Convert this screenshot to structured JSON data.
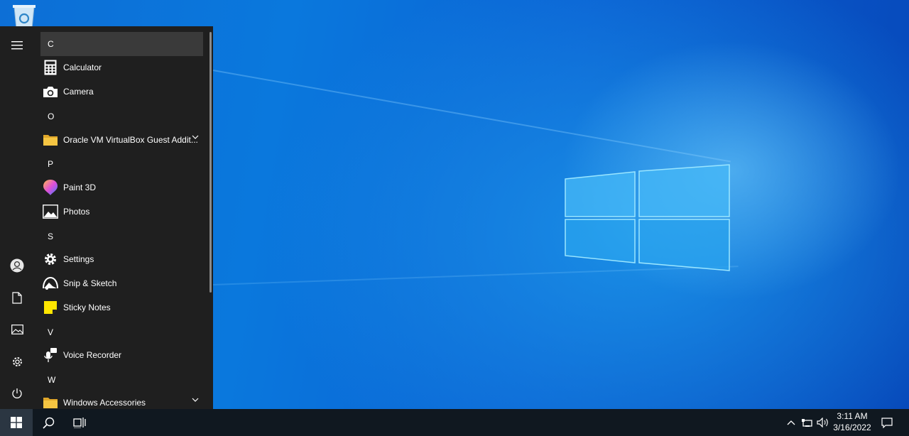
{
  "start_menu": {
    "rail": {
      "menu_icon": "hamburger-icon",
      "items": [
        "account-icon",
        "documents-icon",
        "pictures-icon",
        "settings-icon",
        "power-icon"
      ]
    },
    "groups": [
      {
        "letter": "C",
        "apps": [
          {
            "label": "Calculator",
            "icon": "calculator-icon"
          },
          {
            "label": "Camera",
            "icon": "camera-icon"
          }
        ]
      },
      {
        "letter": "O",
        "apps": [
          {
            "label": "Oracle VM VirtualBox Guest Addit...",
            "icon": "folder-icon",
            "expandable": true
          }
        ]
      },
      {
        "letter": "P",
        "apps": [
          {
            "label": "Paint 3D",
            "icon": "paint3d-icon"
          },
          {
            "label": "Photos",
            "icon": "photos-icon"
          }
        ]
      },
      {
        "letter": "S",
        "apps": [
          {
            "label": "Settings",
            "icon": "gear-icon"
          },
          {
            "label": "Snip & Sketch",
            "icon": "snip-icon"
          },
          {
            "label": "Sticky Notes",
            "icon": "sticky-notes-icon"
          }
        ]
      },
      {
        "letter": "V",
        "apps": [
          {
            "label": "Voice Recorder",
            "icon": "microphone-icon"
          }
        ]
      },
      {
        "letter": "W",
        "apps": [
          {
            "label": "Windows Accessories",
            "icon": "folder-icon",
            "expandable": true
          }
        ]
      }
    ]
  },
  "taskbar": {
    "clock_time": "3:11 AM",
    "clock_date": "3/16/2022"
  },
  "colors": {
    "folder": "#f5c542",
    "sticky": "#ffe600",
    "taskbar": "#101820"
  }
}
